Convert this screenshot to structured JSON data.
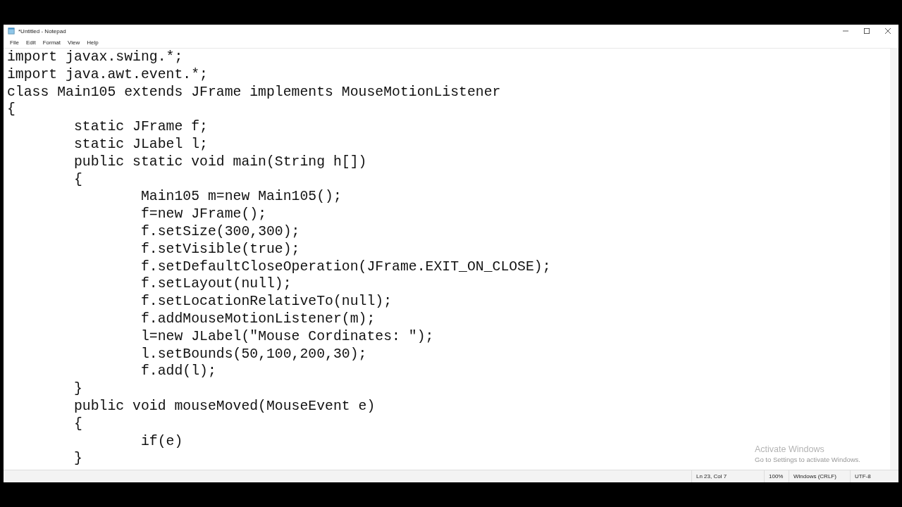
{
  "window": {
    "title": "*Untitled - Notepad"
  },
  "menu": [
    "File",
    "Edit",
    "Format",
    "View",
    "Help"
  ],
  "editor": {
    "lines": [
      "import javax.swing.*;",
      "import java.awt.event.*;",
      "class Main105 extends JFrame implements MouseMotionListener",
      "{",
      "\tstatic JFrame f;",
      "\tstatic JLabel l;",
      "\tpublic static void main(String h[])",
      "\t{",
      "\t\tMain105 m=new Main105();",
      "\t\tf=new JFrame();",
      "\t\tf.setSize(300,300);",
      "\t\tf.setVisible(true);",
      "\t\tf.setDefaultCloseOperation(JFrame.EXIT_ON_CLOSE);",
      "\t\tf.setLayout(null);",
      "\t\tf.setLocationRelativeTo(null);",
      "\t\tf.addMouseMotionListener(m);",
      "\t\tl=new JLabel(\"Mouse Cordinates: \");",
      "\t\tl.setBounds(50,100,200,30);",
      "\t\tf.add(l);",
      "\t}",
      "\tpublic void mouseMoved(MouseEvent e)",
      "\t{",
      "\t\tif(e)",
      "\t}"
    ]
  },
  "activation_notice": {
    "title": "Activate Windows",
    "message": "Go to Settings to activate Windows."
  },
  "status_bar": {
    "position": "Ln 23, Col 7",
    "zoom": "100%",
    "line_ending": "Windows (CRLF)",
    "encoding": "UTF-8"
  }
}
